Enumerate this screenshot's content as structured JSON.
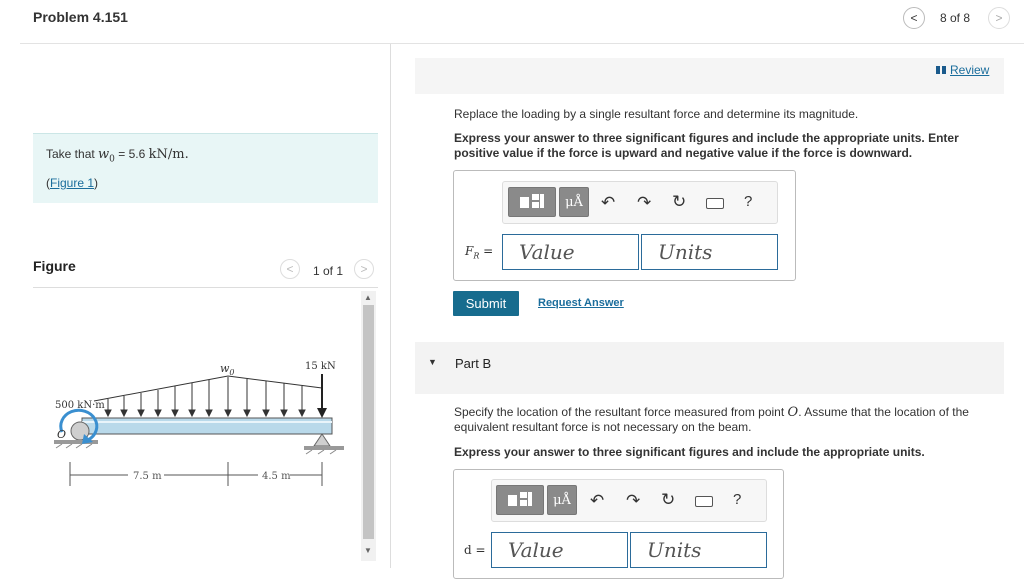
{
  "header": {
    "title": "Problem 4.151",
    "pager": "8 of 8",
    "prev": "<",
    "next": ">"
  },
  "given": {
    "prefix": "Take that ",
    "var": "w",
    "sub": "0",
    "eq": " = 5.6 ",
    "unit": "kN/m.",
    "figure_link": "Figure 1"
  },
  "figure": {
    "heading": "Figure",
    "pager": "1 of 1",
    "labels": {
      "w0": "w",
      "w0_sub": "0",
      "force": "15 kN",
      "moment": "500 kN·m",
      "point": "O",
      "dim1": "7.5 m",
      "dim2": "4.5 m"
    }
  },
  "review": "Review",
  "partA": {
    "prompt": "Replace the loading by a single resultant force and determine its magnitude.",
    "instructions": "Express your answer to three significant figures and include the appropriate units. Enter positive value if the force is upward and negative value if the force is downward.",
    "label_var": "F",
    "label_sub": "R",
    "label_eq": " =",
    "value_placeholder": "Value",
    "units_placeholder": "Units",
    "submit": "Submit",
    "request": "Request Answer"
  },
  "partB": {
    "title": "Part B",
    "prompt_before": "Specify the location of the resultant force measured from point ",
    "prompt_point": "O",
    "prompt_after": ". Assume that the location of the equivalent resultant force is not necessary on the beam.",
    "instructions": "Express your answer to three significant figures and include the appropriate units.",
    "label": "d =",
    "value_placeholder": "Value",
    "units_placeholder": "Units"
  },
  "toolbar": {
    "mu": "μÅ",
    "help": "?"
  },
  "colors": {
    "accent": "#176c8e",
    "link": "#1a6d9c",
    "given_bg": "#e8f6f6",
    "beam": "#b9d9ea",
    "moment_arrow": "#3a8fd0"
  }
}
